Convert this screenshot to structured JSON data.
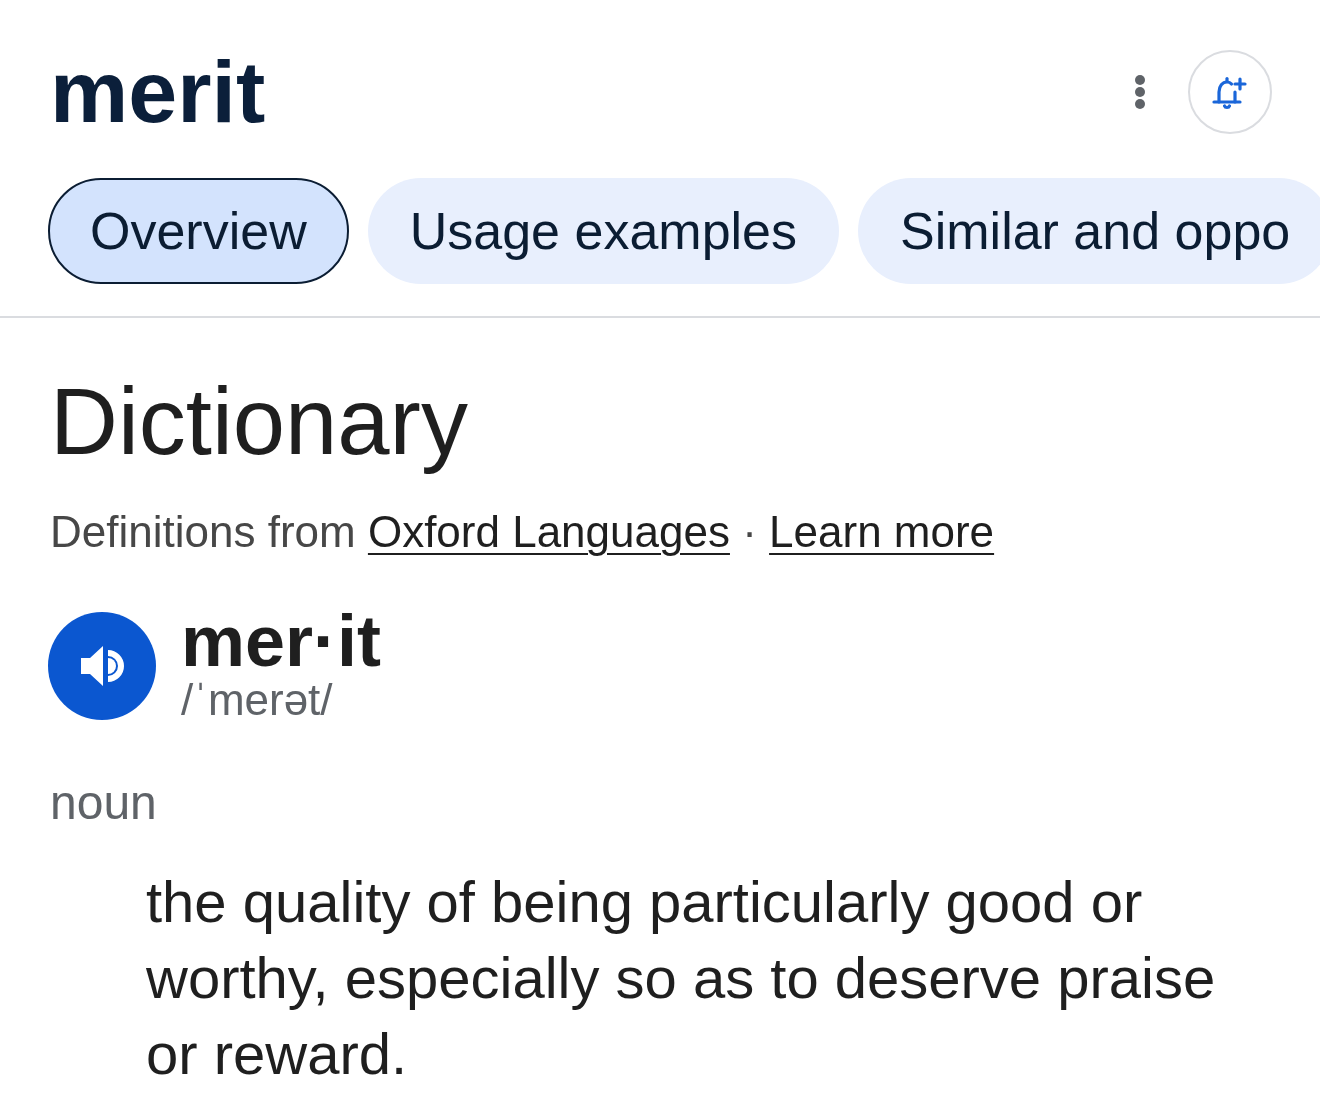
{
  "header": {
    "title": "merit"
  },
  "tabs": [
    {
      "label": "Overview",
      "selected": true
    },
    {
      "label": "Usage examples",
      "selected": false
    },
    {
      "label": "Similar and oppo",
      "selected": false
    }
  ],
  "dictionary": {
    "heading": "Dictionary",
    "attribution": {
      "prefix": "Definitions from",
      "source_link": "Oxford Languages",
      "separator": "·",
      "more_link": "Learn more"
    },
    "entry": {
      "headword": "mer·it",
      "pronunciation": "/ˈmerət/"
    },
    "senses": [
      {
        "part_of_speech": "noun",
        "definitions": [
          "the quality of being particularly good or worthy, especially so as to deserve praise or reward."
        ]
      }
    ]
  }
}
